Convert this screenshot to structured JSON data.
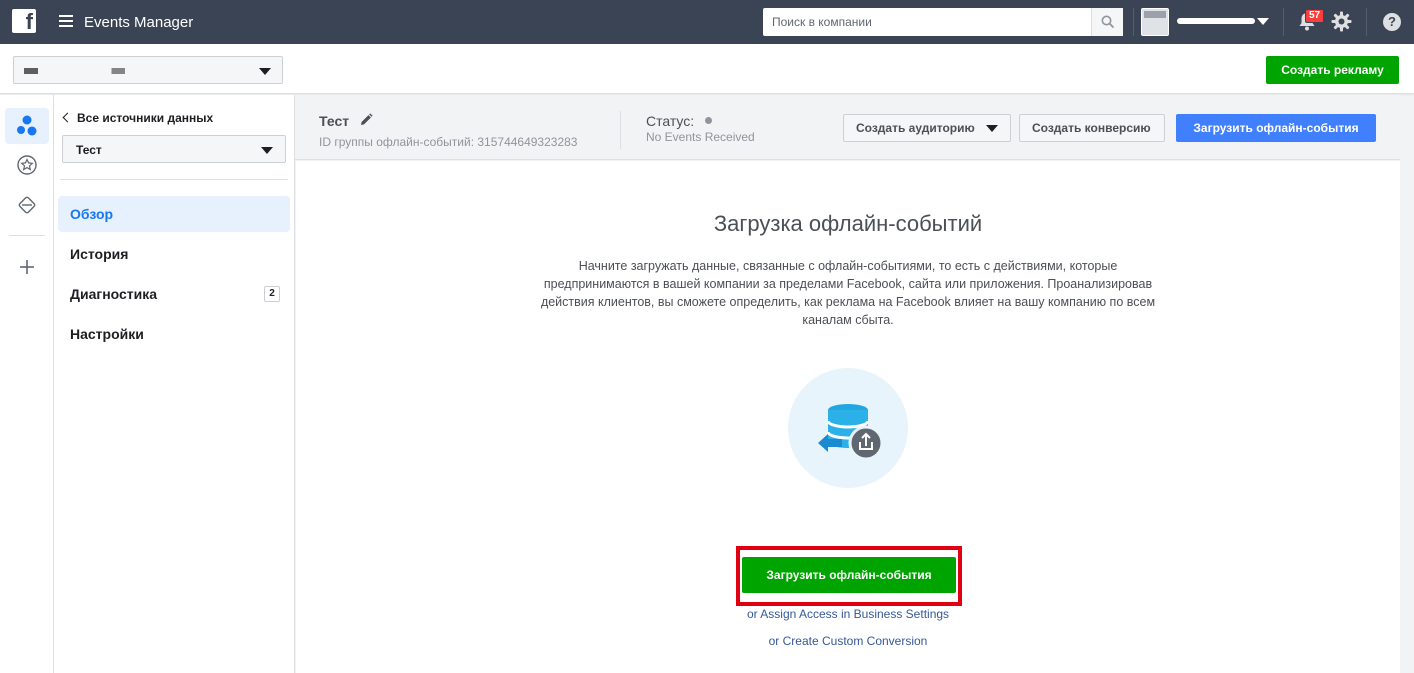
{
  "topbar": {
    "app_title": "Events Manager",
    "search_placeholder": "Поиск в компании",
    "notification_count": "57"
  },
  "subbar": {
    "create_ad_label": "Создать рекламу"
  },
  "leftnav": {
    "back_label": "Все источники данных",
    "source_selected": "Тест",
    "items": [
      {
        "label": "Обзор",
        "active": true
      },
      {
        "label": "История"
      },
      {
        "label": "Диагностика",
        "badge": "2"
      },
      {
        "label": "Настройки"
      }
    ]
  },
  "pagehead": {
    "title": "Тест",
    "id_text": "ID группы офлайн-событий: 315744649323283",
    "status_label": "Статус:",
    "status_value": "No Events Received",
    "create_audience_label": "Создать аудиторию",
    "create_conversion_label": "Создать конверсию",
    "upload_label": "Загрузить офлайн-события"
  },
  "main": {
    "title": "Загрузка офлайн-событий",
    "description": "Начните загружать данные, связанные с офлайн-событиями, то есть с действиями, которые предпринимаются в вашей компании за пределами Facebook, сайта или приложения. Проанализировав действия клиентов, вы сможете определить, как реклама на Facebook влияет на вашу компанию по всем каналам сбыта.",
    "upload_button_label": "Загрузить офлайн-события",
    "assign_access_link": "or Assign Access in Business Settings",
    "custom_conversion_link": "or Create Custom Conversion"
  },
  "colors": {
    "topbar": "#3b4454",
    "green": "#00a400",
    "blue": "#4080ff",
    "highlight": "#e00012",
    "link": "#365899"
  },
  "icons": [
    "facebook-logo-icon",
    "menu-icon",
    "search-icon",
    "bell-icon",
    "gear-icon",
    "help-icon",
    "pencil-icon",
    "database-upload-icon"
  ]
}
